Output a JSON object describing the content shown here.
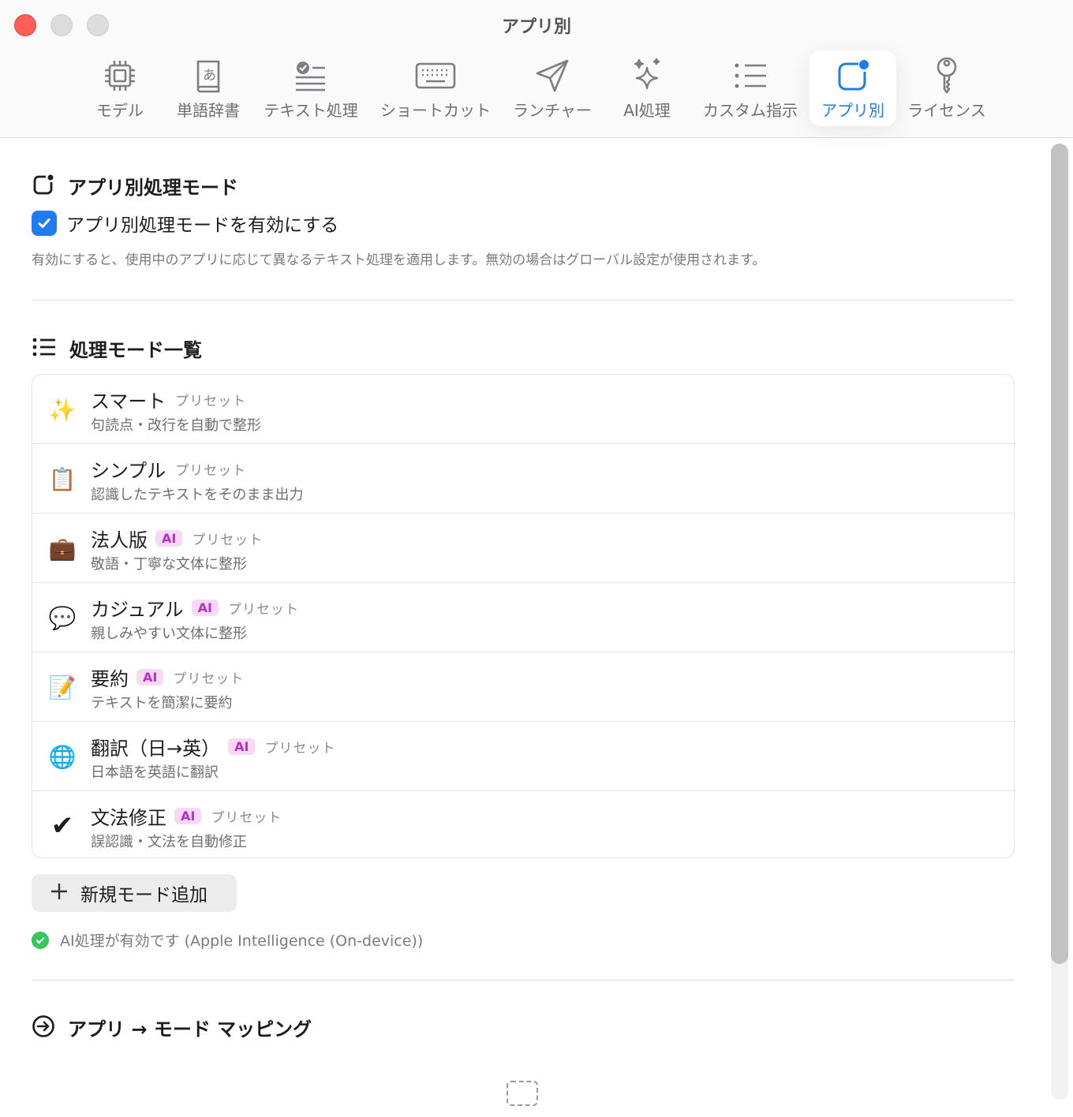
{
  "window": {
    "title": "アプリ別"
  },
  "toolbar": {
    "tabs": [
      {
        "label": "モデル",
        "icon": "cpu-icon"
      },
      {
        "label": "単語辞書",
        "icon": "dictionary-icon"
      },
      {
        "label": "テキスト処理",
        "icon": "text-check-icon"
      },
      {
        "label": "ショートカット",
        "icon": "keyboard-icon"
      },
      {
        "label": "ランチャー",
        "icon": "paper-plane-icon"
      },
      {
        "label": "AI処理",
        "icon": "sparkles-icon"
      },
      {
        "label": "カスタム指示",
        "icon": "list-star-icon"
      },
      {
        "label": "アプリ別",
        "icon": "app-badge-icon",
        "active": true
      },
      {
        "label": "ライセンス",
        "icon": "key-icon"
      }
    ],
    "accent": "#1f7cf0"
  },
  "per_app": {
    "title": "アプリ別処理モード",
    "checkbox_label": "アプリ別処理モードを有効にする",
    "checkbox_checked": true,
    "description": "有効にすると、使用中のアプリに応じて異なるテキスト処理を適用します。無効の場合はグローバル設定が使用されます。"
  },
  "modes_section": {
    "title": "処理モード一覧",
    "preset_label": "プリセット",
    "ai_badge": "AI",
    "modes": [
      {
        "name": "スマート",
        "sub": "句読点・改行を自動で整形",
        "icon": "✨",
        "ai": false
      },
      {
        "name": "シンプル",
        "sub": "認識したテキストをそのまま出力",
        "icon": "📋",
        "ai": false
      },
      {
        "name": "法人版",
        "sub": "敬語・丁寧な文体に整形",
        "icon": "💼",
        "ai": true
      },
      {
        "name": "カジュアル",
        "sub": "親しみやすい文体に整形",
        "icon": "💬",
        "ai": true
      },
      {
        "name": "要約",
        "sub": "テキストを簡潔に要約",
        "icon": "📝",
        "ai": true
      },
      {
        "name": "翻訳（日→英）",
        "sub": "日本語を英語に翻訳",
        "icon": "🌐",
        "ai": true
      },
      {
        "name": "文法修正",
        "sub": "誤認識・文法を自動修正",
        "icon": "✔",
        "ai": true
      }
    ],
    "add_button": "新規モード追加",
    "ai_status": "AI処理が有効です (Apple Intelligence (On-device))",
    "status_color": "#34c759",
    "badge_color": "#b82ed0"
  },
  "mapping_section": {
    "title": "アプリ → モード マッピング"
  }
}
